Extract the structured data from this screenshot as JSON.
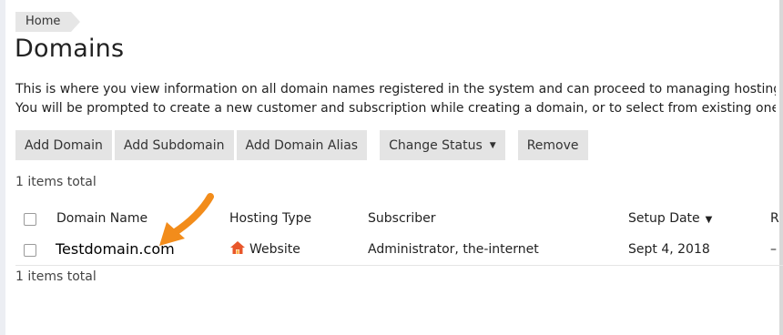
{
  "breadcrumb": {
    "home": "Home"
  },
  "page": {
    "title": "Domains",
    "description_line1": "This is where you view information on all domain names registered in the system and can proceed to managing hosting",
    "description_line2": "You will be prompted to create a new customer and subscription while creating a domain, or to select from existing one"
  },
  "toolbar": {
    "add_domain": "Add Domain",
    "add_subdomain": "Add Subdomain",
    "add_domain_alias": "Add Domain Alias",
    "change_status": "Change Status",
    "remove": "Remove"
  },
  "items_total_top": "1 items total",
  "items_total_bottom": "1 items total",
  "table": {
    "headers": {
      "domain_name": "Domain Name",
      "hosting_type": "Hosting Type",
      "subscriber": "Subscriber",
      "setup_date": "Setup Date",
      "next": "R"
    },
    "rows": [
      {
        "domain_name": "Testdomain.com",
        "hosting_type": "Website",
        "subscriber": "Administrator, the-internet",
        "setup_date": "Sept 4, 2018",
        "next": "–"
      }
    ]
  },
  "icons": {
    "home": "home-icon",
    "sort": "chevron-down-icon",
    "caret": "caret-down-icon",
    "annotation": "orange-arrow-icon"
  },
  "colors": {
    "accent_orange": "#f28c1b",
    "home_icon": "#e8562a",
    "button_bg": "#e4e4e4"
  }
}
